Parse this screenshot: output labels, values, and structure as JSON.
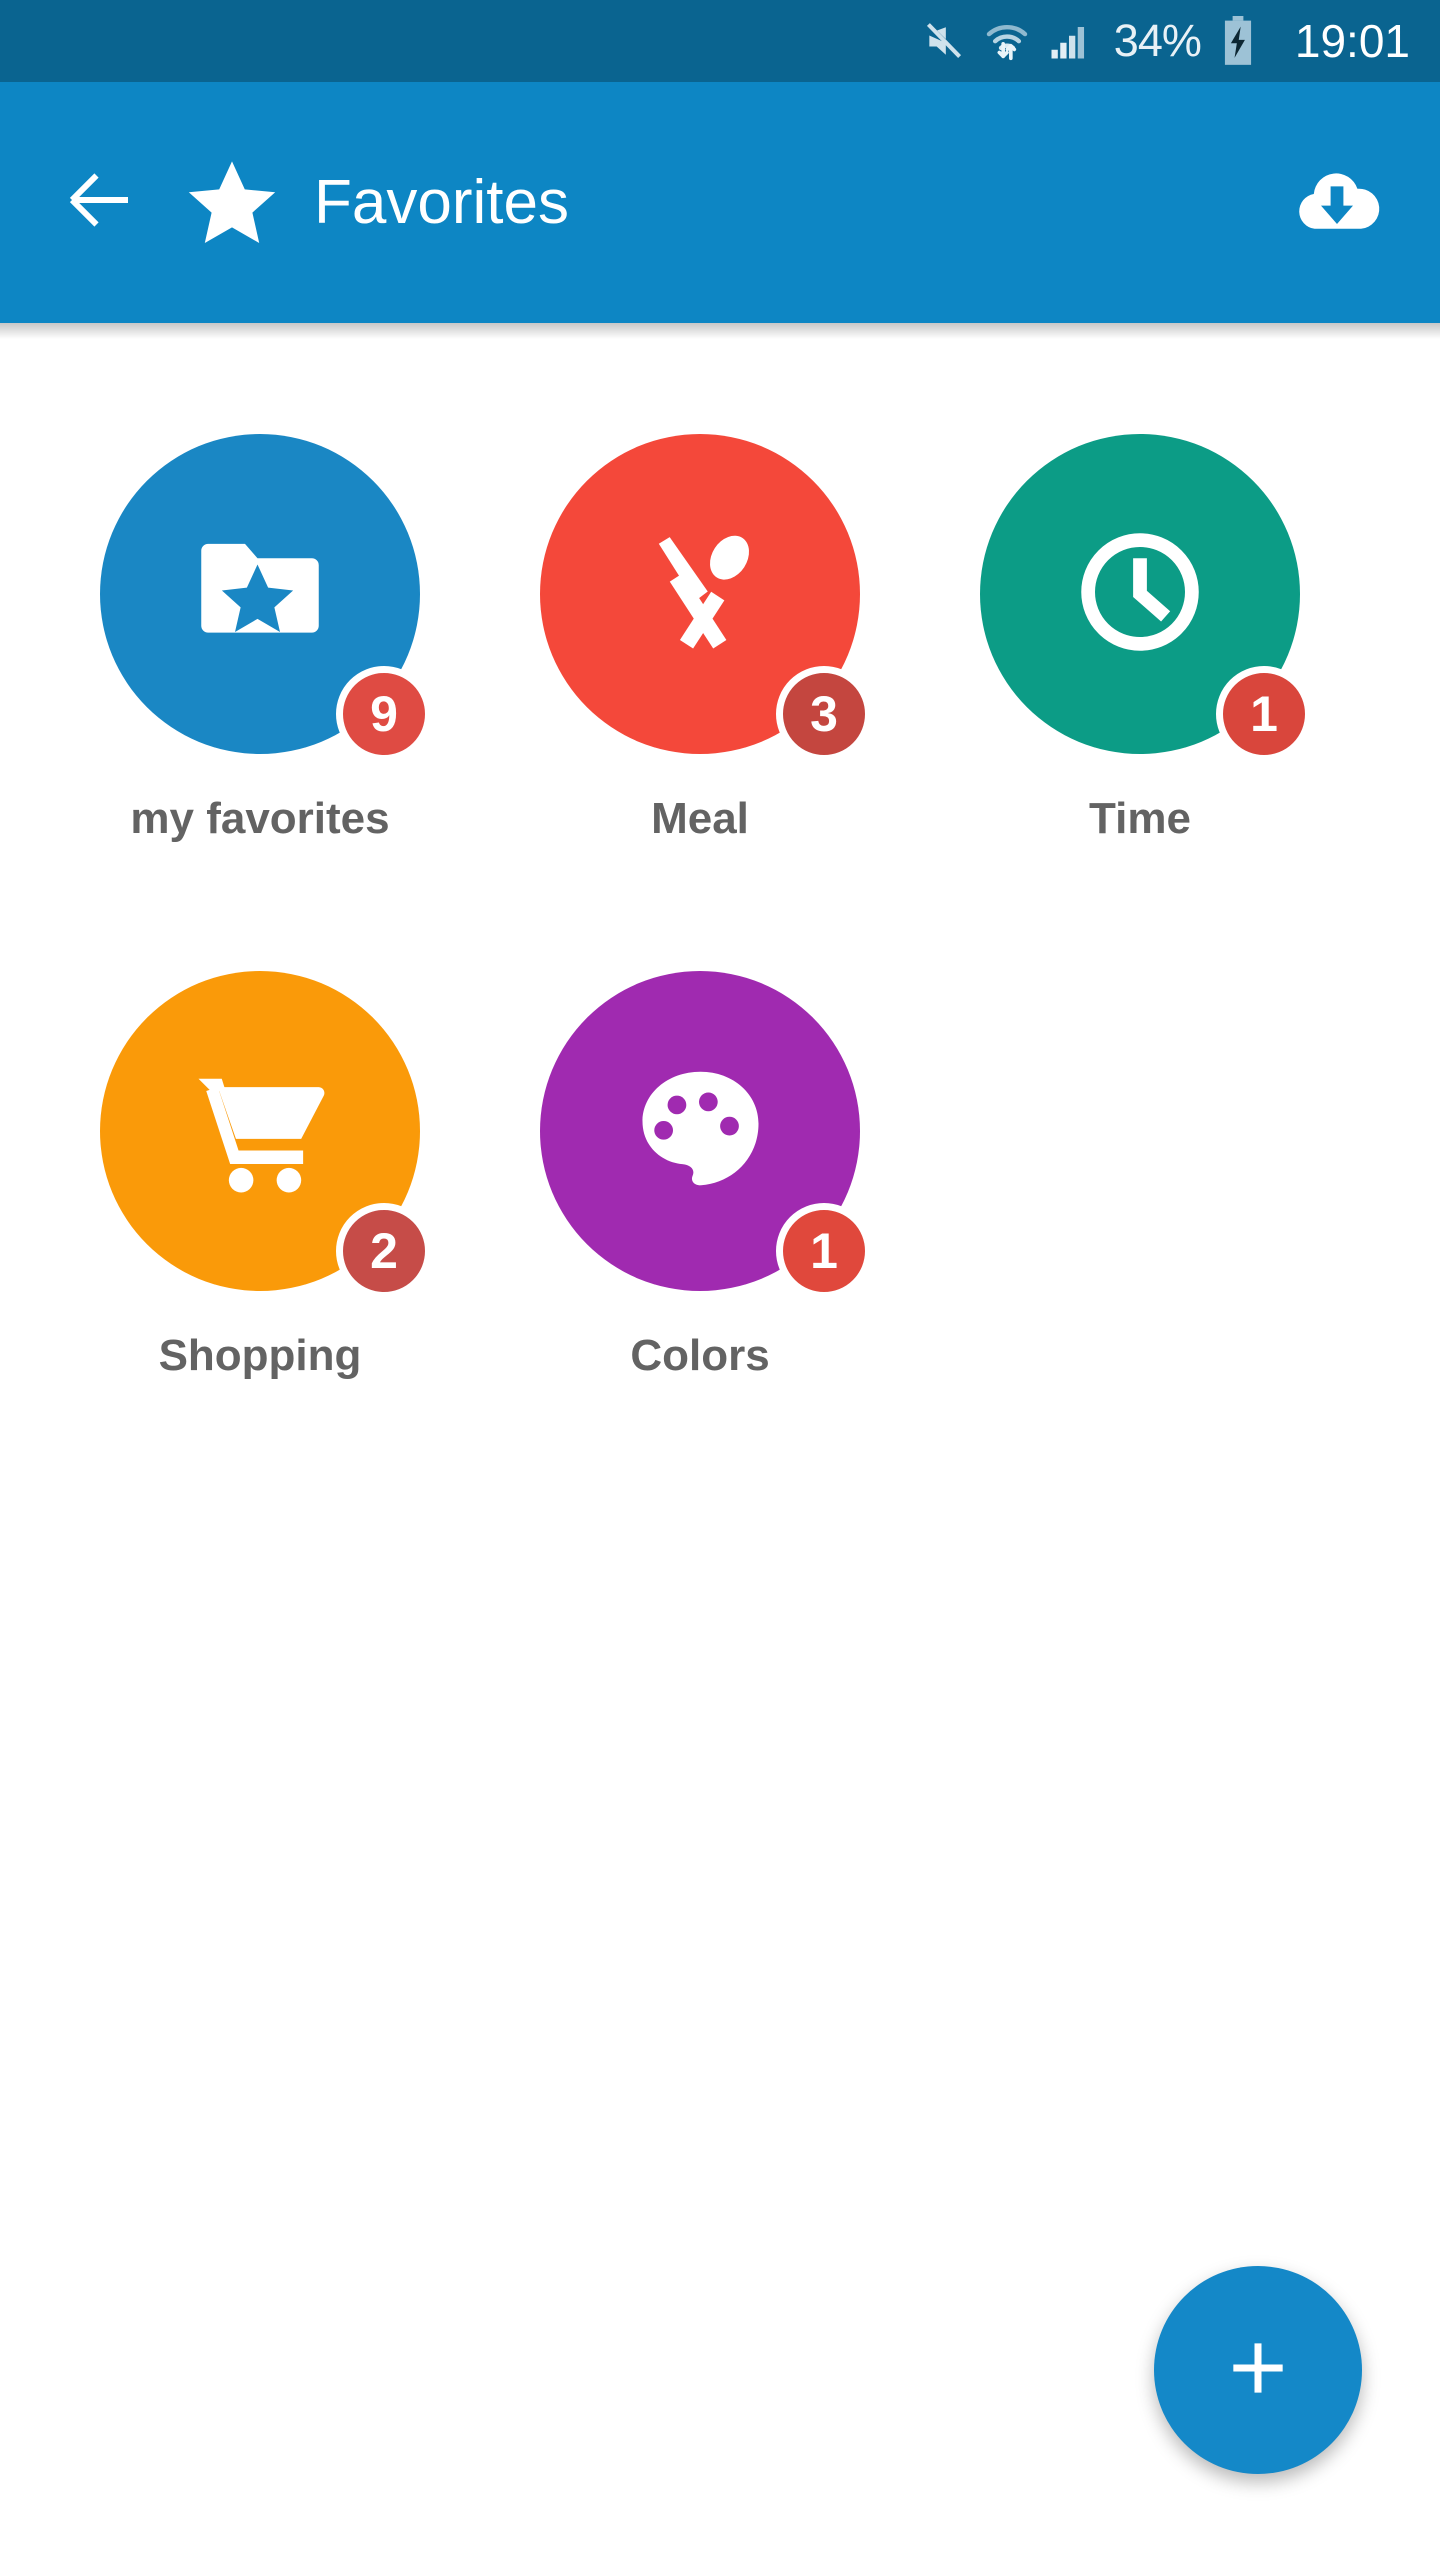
{
  "status_bar": {
    "background": "#0a6490",
    "mute_icon": "mute-icon",
    "wifi_icon": "wifi-transfer-icon",
    "signal_icon": "cellular-signal-icon",
    "battery_percent": "34%",
    "battery_icon": "battery-charging-icon",
    "time": "19:01"
  },
  "app_bar": {
    "background": "#0d86c4",
    "back_icon": "back-arrow-icon",
    "star_icon": "star-icon",
    "title": "Favorites",
    "download_icon": "cloud-download-icon"
  },
  "grid": {
    "items": [
      {
        "label": "my favorites",
        "icon": "folder-star-icon",
        "color": "#1a87c4",
        "badge": "9",
        "badge_color": "#df4b43"
      },
      {
        "label": "Meal",
        "icon": "knife-spoon-icon",
        "color": "#f4483a",
        "badge": "3",
        "badge_color": "#c4463f"
      },
      {
        "label": "Time",
        "icon": "clock-icon",
        "color": "#0c9c86",
        "badge": "1",
        "badge_color": "#d9463c"
      },
      {
        "label": "Shopping",
        "icon": "shopping-cart-icon",
        "color": "#fa9a09",
        "badge": "2",
        "badge_color": "#c64c48"
      },
      {
        "label": "Colors",
        "icon": "palette-icon",
        "color": "#a02ab0",
        "badge": "1",
        "badge_color": "#e0483c"
      }
    ]
  },
  "fab": {
    "label": "+",
    "icon": "plus-icon",
    "color": "#1488c8"
  }
}
